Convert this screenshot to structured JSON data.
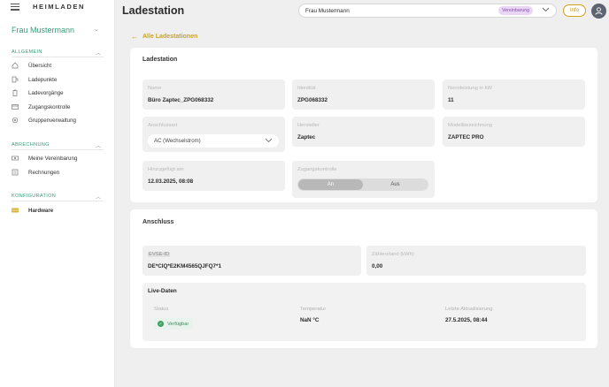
{
  "sidebar": {
    "logo": "HEIMLADEN",
    "user_name": "Frau Mustermann",
    "sections": [
      {
        "title": "ALLGEMEIN",
        "items": [
          {
            "label": "Übersicht",
            "icon": "home-icon"
          },
          {
            "label": "Ladepunkte",
            "icon": "charger-icon"
          },
          {
            "label": "Ladevorgänge",
            "icon": "battery-icon"
          },
          {
            "label": "Zugangskontrolle",
            "icon": "card-icon"
          },
          {
            "label": "Gruppenverwaltung",
            "icon": "gear-icon"
          }
        ]
      },
      {
        "title": "ABRECHNUNG",
        "items": [
          {
            "label": "Meine Vereinbarung",
            "icon": "money-icon"
          },
          {
            "label": "Rechnungen",
            "icon": "invoice-icon"
          }
        ]
      },
      {
        "title": "KONFIGURATION",
        "items": [
          {
            "label": "Hardware",
            "icon": "hardware-icon",
            "active": true
          }
        ]
      }
    ]
  },
  "header": {
    "title": "Ladestation",
    "user_select": "Frau Mustermann",
    "badge": "Vereinbarung",
    "info_label": "Info"
  },
  "back_link": "Alle Ladestationen",
  "ladestation": {
    "title": "Ladestation",
    "name": {
      "label": "Name",
      "value": "Büro Zaptec_ZPG068332"
    },
    "identitaet": {
      "label": "Identität",
      "value": "ZPG068332"
    },
    "nennleistung": {
      "label": "Nennleistung in kW",
      "value": "11"
    },
    "anschlussart": {
      "label": "Anschlussart",
      "value": "AC (Wechselstrom)"
    },
    "hersteller": {
      "label": "Hersteller",
      "value": "Zaptec"
    },
    "modell": {
      "label": "Modellbezeichnung",
      "value": "ZAPTEC PRO"
    },
    "hinzugefuegt": {
      "label": "Hinzugefügt am",
      "value": "12.03.2025, 08:08"
    },
    "zugangskontrolle": {
      "label": "Zugangskontrolle",
      "on": "An",
      "off": "Aus",
      "selected": "An"
    }
  },
  "anschluss": {
    "title": "Anschluss",
    "evse": {
      "label": "EVSE-ID",
      "value": "DE*CIQ*E2KM4565QJFQ7*1"
    },
    "zaehlerstand": {
      "label": "Zählerstand (kWh)",
      "value": "0,00"
    },
    "live": {
      "title": "Live-Daten",
      "status_label": "Status",
      "status_value": "Verfügbar",
      "temperatur_label": "Temperatur",
      "temperatur_value": "NaN °C",
      "aktualisierung_label": "Letzte Aktualisierung",
      "aktualisierung_value": "27.5.2025, 08:44"
    }
  },
  "colors": {
    "accent": "#3a9a7a",
    "gold": "#c9a227",
    "badge_bg": "#e9d6f5",
    "status_green": "#3f9f62"
  }
}
